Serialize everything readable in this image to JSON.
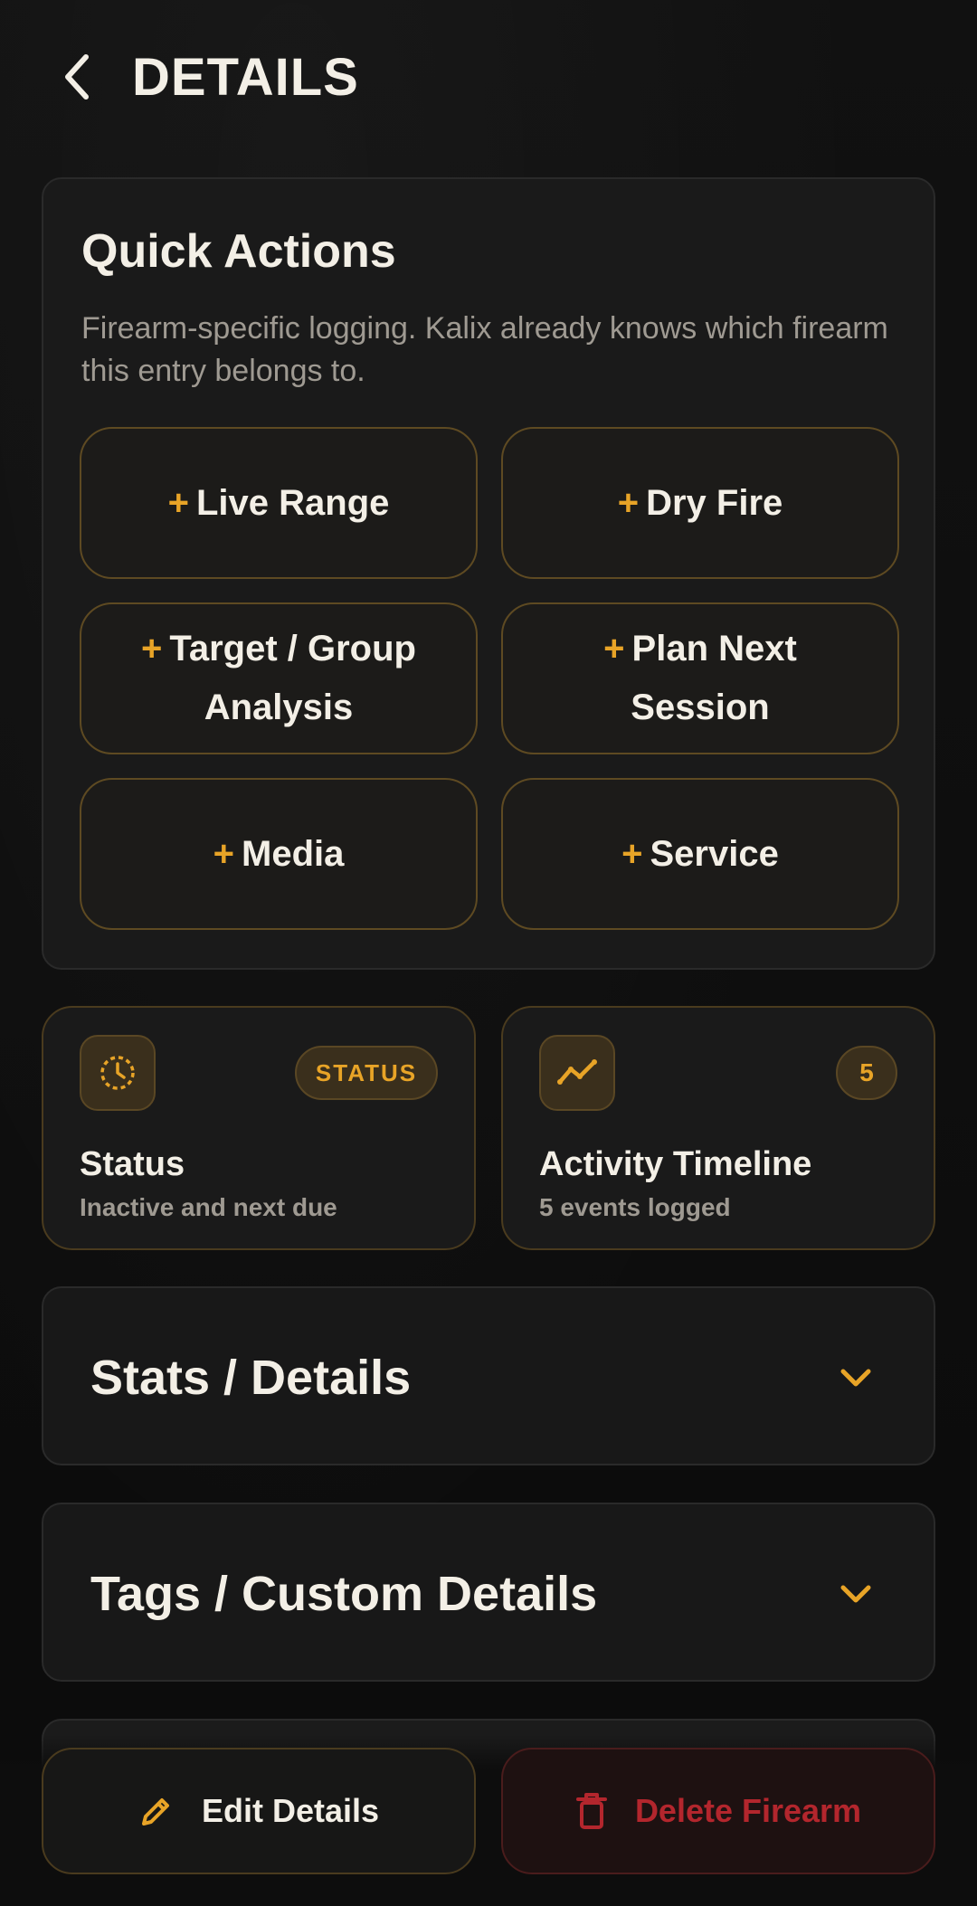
{
  "header": {
    "back_icon": "chevron-left-icon",
    "title": "DETAILS"
  },
  "quick_actions": {
    "title": "Quick Actions",
    "description": "Firearm-specific logging. Kalix already knows which firearm this entry belongs to.",
    "plus": "+",
    "buttons": [
      {
        "label": "Live Range"
      },
      {
        "label": "Dry Fire"
      },
      {
        "label": "Target / Group Analysis"
      },
      {
        "label": "Plan Next Session"
      },
      {
        "label": "Media"
      },
      {
        "label": "Service"
      }
    ]
  },
  "status_card": {
    "icon": "clock-icon",
    "badge": "STATUS",
    "title": "Status",
    "subtitle": "Inactive and next due"
  },
  "timeline_card": {
    "icon": "trend-line-icon",
    "badge": "5",
    "title": "Activity Timeline",
    "subtitle": "5 events logged"
  },
  "accordions": [
    {
      "title": "Stats / Details",
      "icon": "chevron-down-icon"
    },
    {
      "title": "Tags / Custom Details",
      "icon": "chevron-down-icon"
    }
  ],
  "bottom_actions": {
    "edit_label": "Edit Details",
    "edit_icon": "pencil-icon",
    "delete_label": "Delete Firearm",
    "delete_icon": "trash-icon"
  },
  "colors": {
    "accent": "#e8a427",
    "danger": "#b3262d",
    "background": "#0d0d0d",
    "card": "#1a1a1a",
    "text": "#f3efe6",
    "muted": "#9f9a92"
  }
}
